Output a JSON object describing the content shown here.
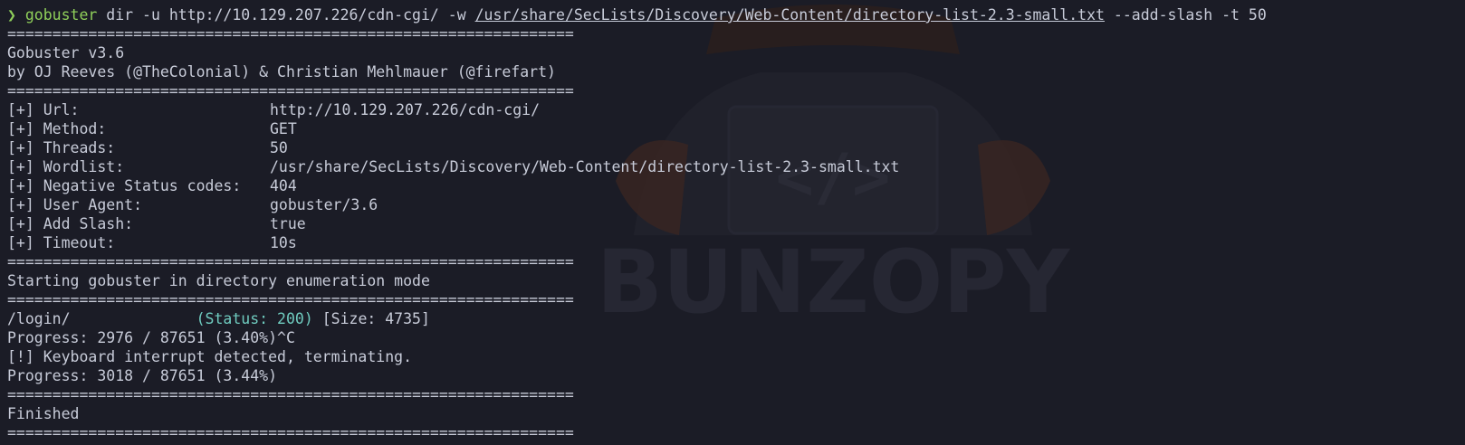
{
  "watermark": {
    "brand": "BUNZOPY",
    "code_glyph": "</>"
  },
  "command": {
    "prompt": "❯",
    "program": "gobuster",
    "args_before": " dir -u http://10.129.207.226/cdn-cgi/ -w ",
    "wordlist": "/usr/share/SecLists/Discovery/Web-Content/directory-list-2.3-small.txt",
    "args_after": " --add-slash -t 50"
  },
  "rule": "===============================================================",
  "banner": {
    "version": "Gobuster v3.6",
    "authors": "by OJ Reeves (@TheColonial) & Christian Mehlmauer (@firefart)"
  },
  "config": [
    {
      "key": "[+] Url:",
      "value": "http://10.129.207.226/cdn-cgi/"
    },
    {
      "key": "[+] Method:",
      "value": "GET"
    },
    {
      "key": "[+] Threads:",
      "value": "50"
    },
    {
      "key": "[+] Wordlist:",
      "value": "/usr/share/SecLists/Discovery/Web-Content/directory-list-2.3-small.txt"
    },
    {
      "key": "[+] Negative Status codes:",
      "value": "404"
    },
    {
      "key": "[+] User Agent:",
      "value": "gobuster/3.6"
    },
    {
      "key": "[+] Add Slash:",
      "value": "true"
    },
    {
      "key": "[+] Timeout:",
      "value": "10s"
    }
  ],
  "start_message": "Starting gobuster in directory enumeration mode",
  "result": {
    "path": "/login/",
    "status": "(Status: 200)",
    "size": "[Size: 4735]"
  },
  "progress_1": "Progress: 2976 / 87651 (3.40%)^C",
  "interrupt": "[!] Keyboard interrupt detected, terminating.",
  "progress_2": "Progress: 3018 / 87651 (3.44%)",
  "finished": "Finished"
}
